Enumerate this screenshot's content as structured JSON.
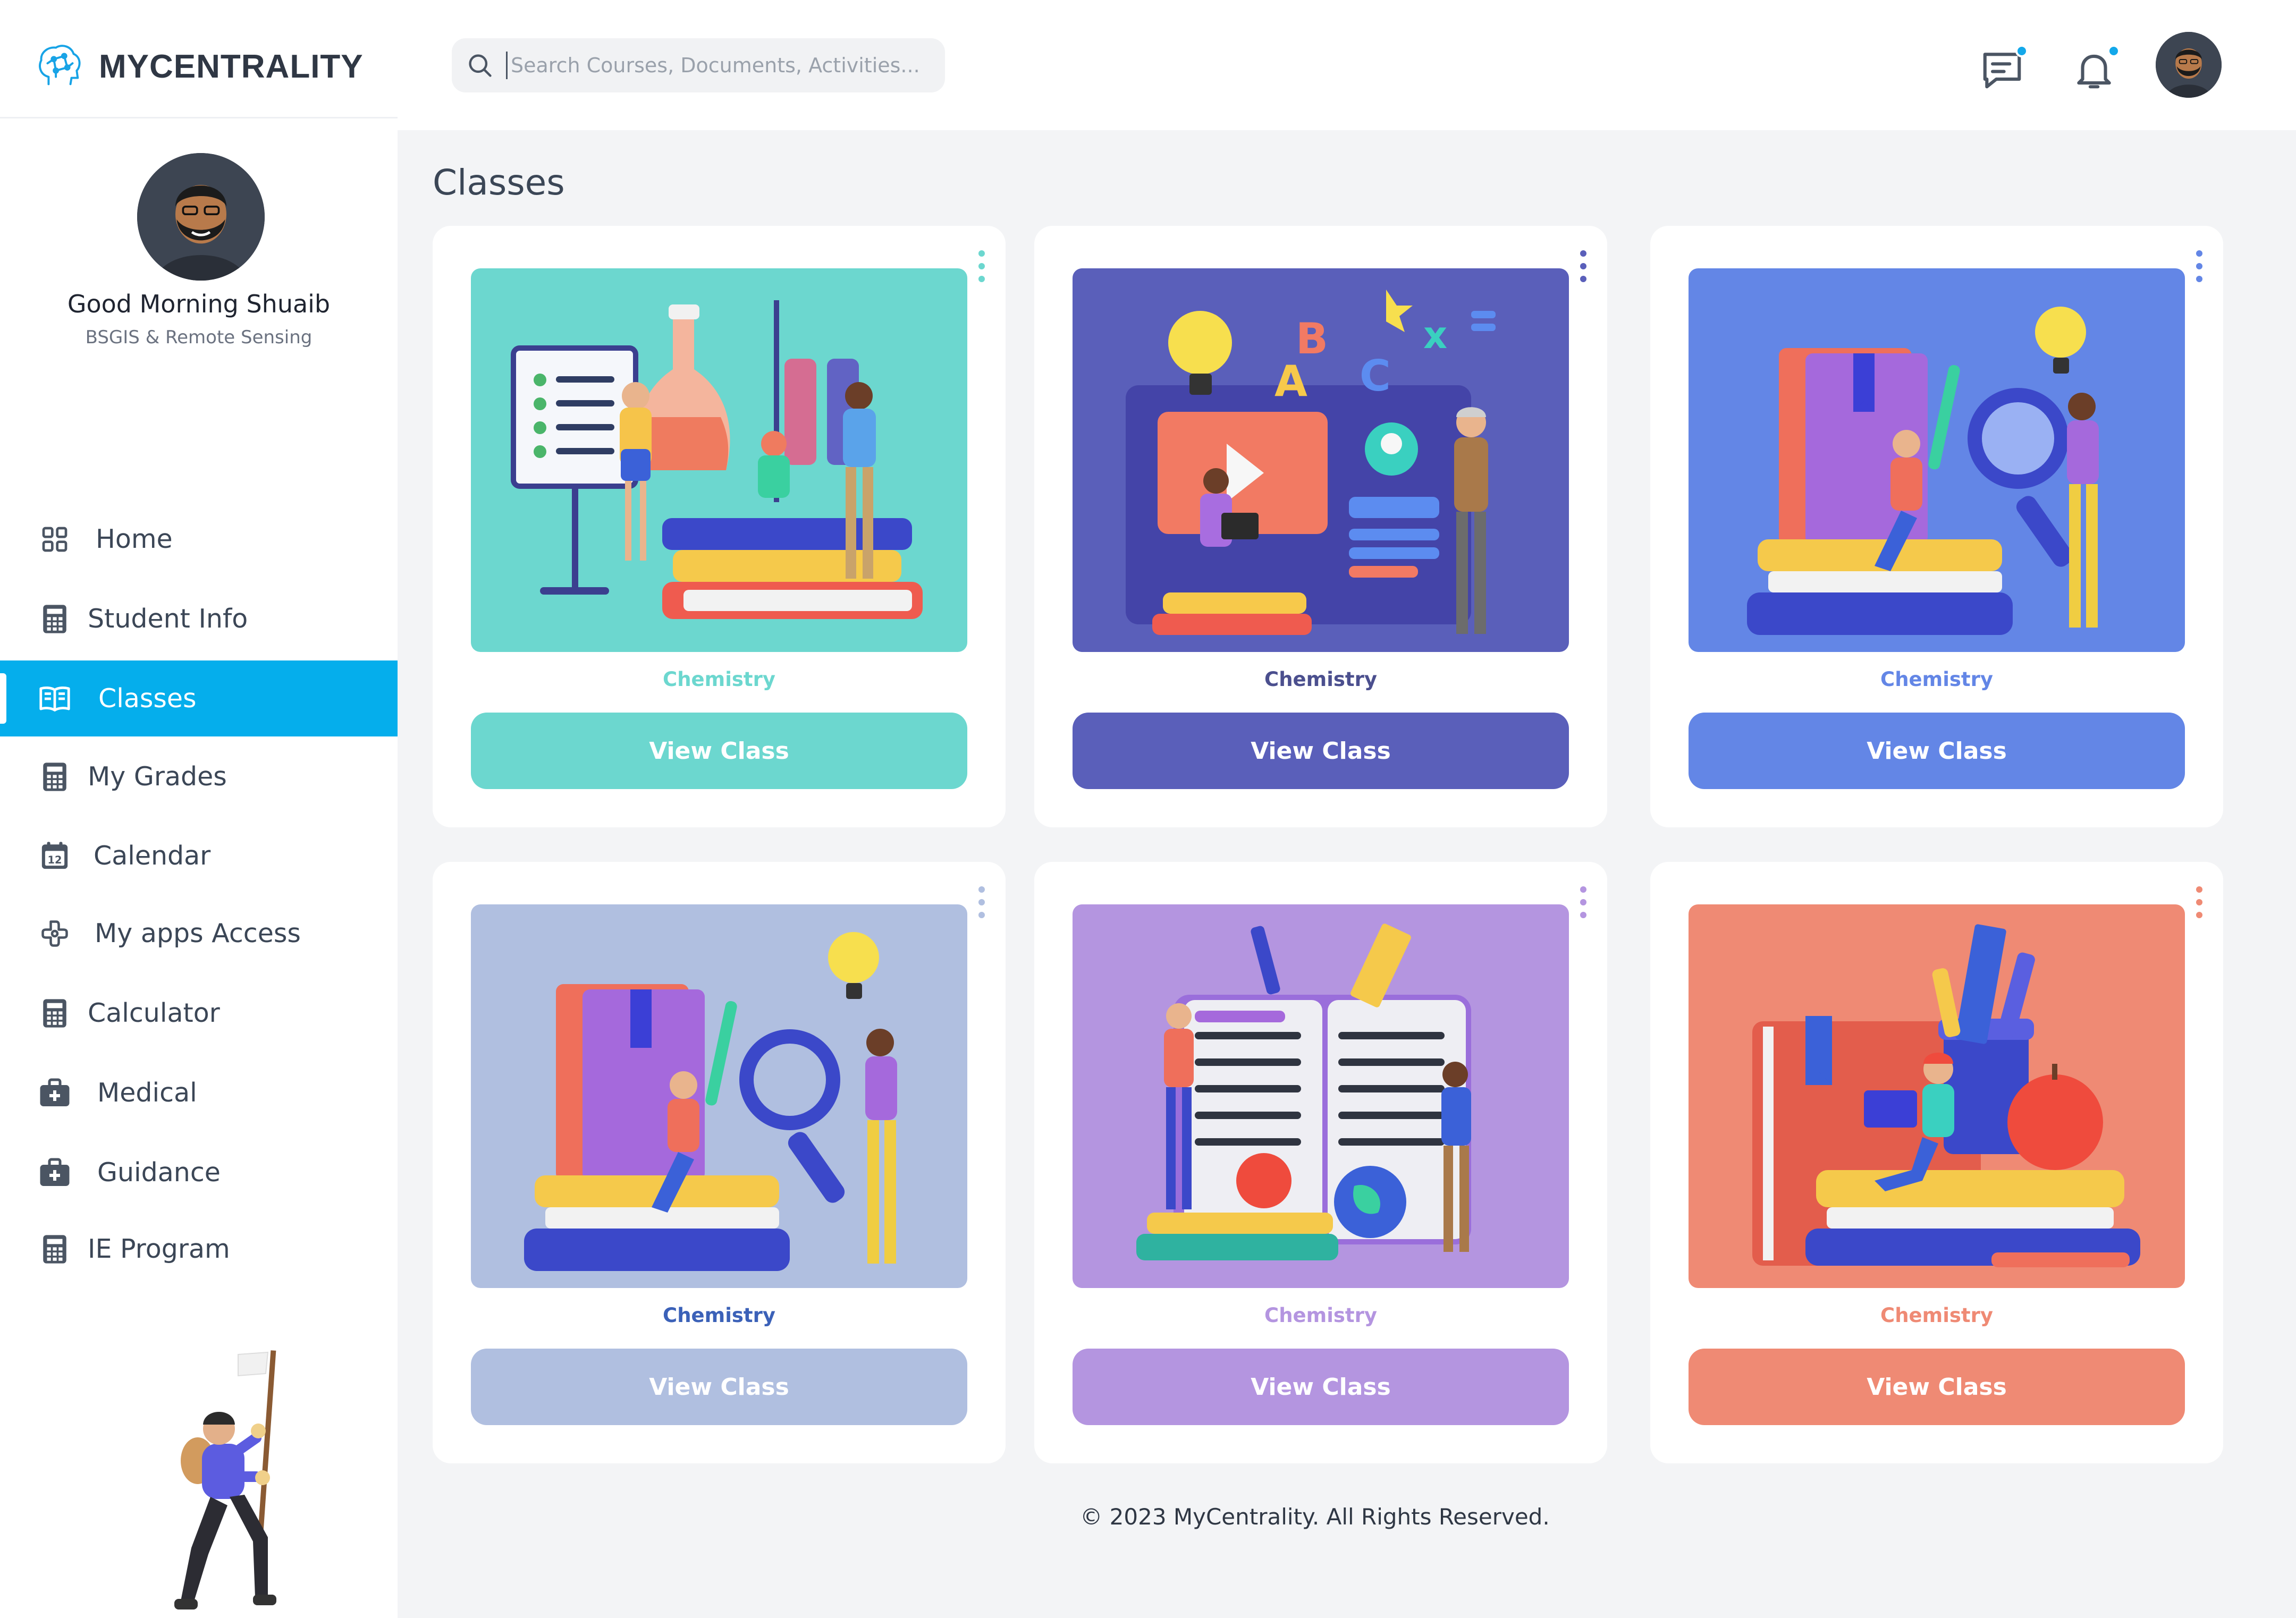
{
  "app": {
    "name": "MYCENTRALITY"
  },
  "search": {
    "placeholder": "Search Courses, Documents, Activities..."
  },
  "header": {
    "icons": [
      "message-icon",
      "bell-icon"
    ],
    "notification_dot_color": "#13a8ea"
  },
  "profile": {
    "greeting": "Good Morning Shuaib",
    "program": "BSGIS & Remote Sensing"
  },
  "sidebar": {
    "accent": "#05aeec",
    "items": [
      {
        "label": "Home",
        "icon": "grid-icon",
        "active": false
      },
      {
        "label": "Student Info",
        "icon": "calculator-icon",
        "active": false
      },
      {
        "label": "Classes",
        "icon": "book-open-icon",
        "active": true
      },
      {
        "label": "My Grades",
        "icon": "calculator-icon",
        "active": false
      },
      {
        "label": "Calendar",
        "icon": "calendar-icon",
        "active": false
      },
      {
        "label": "My apps Access",
        "icon": "apps-icon",
        "active": false
      },
      {
        "label": "Calculator",
        "icon": "calculator-icon",
        "active": false
      },
      {
        "label": "Medical",
        "icon": "medical-kit-icon",
        "active": false
      },
      {
        "label": "Guidance",
        "icon": "medical-kit-icon",
        "active": false
      },
      {
        "label": "IE Program",
        "icon": "calculator-icon",
        "active": false
      }
    ]
  },
  "main": {
    "title": "Classes",
    "cards": [
      {
        "subject": "Chemistry",
        "button": "View Class",
        "color": "#6cd7cf"
      },
      {
        "subject": "Chemistry",
        "button": "View Class",
        "color": "#5a5fba"
      },
      {
        "subject": "Chemistry",
        "button": "View Class",
        "color": "#6386e6"
      },
      {
        "subject": "Chemistry",
        "button": "View Class",
        "color": "#b0bfe0"
      },
      {
        "subject": "Chemistry",
        "button": "View Class",
        "color": "#b495e0"
      },
      {
        "subject": "Chemistry",
        "button": "View Class",
        "color": "#ef8a74"
      }
    ]
  },
  "footer": {
    "text": "© 2023 MyCentrality. All Rights Reserved."
  }
}
